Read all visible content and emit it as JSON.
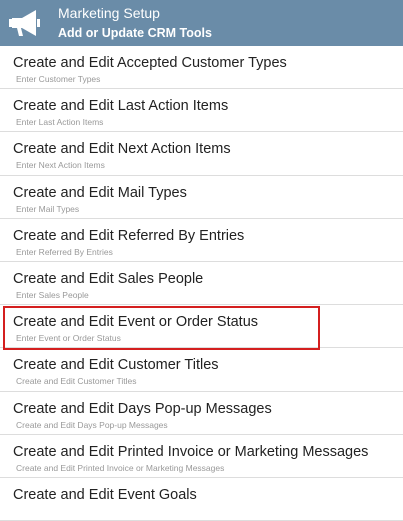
{
  "header": {
    "title": "Marketing Setup",
    "subtitle": "Add or Update CRM Tools",
    "icon": "megaphone-icon",
    "background_color": "#6a8ca8"
  },
  "items": [
    {
      "label": "Create and Edit Accepted Customer Types",
      "sub": "Enter Customer Types"
    },
    {
      "label": "Create and Edit Last Action Items",
      "sub": "Enter Last Action Items"
    },
    {
      "label": "Create and Edit Next Action Items",
      "sub": "Enter Next Action Items"
    },
    {
      "label": "Create and Edit Mail Types",
      "sub": "Enter Mail Types"
    },
    {
      "label": "Create and Edit Referred By Entries",
      "sub": "Enter Referred By Entries"
    },
    {
      "label": "Create and Edit Sales People",
      "sub": "Enter Sales People"
    },
    {
      "label": "Create and Edit Event or Order Status",
      "sub": "Enter Event or Order Status",
      "highlighted": true
    },
    {
      "label": "Create and Edit Customer Titles",
      "sub": "Create and Edit Customer Titles"
    },
    {
      "label": "Create and Edit Days Pop-up Messages",
      "sub": "Create and Edit Days Pop-up Messages"
    },
    {
      "label": "Create and Edit Printed Invoice or Marketing Messages",
      "sub": "Create and Edit Printed Invoice or Marketing Messages"
    },
    {
      "label": "Create and Edit Event Goals",
      "sub": ""
    }
  ],
  "highlight_color": "#d41f1f"
}
